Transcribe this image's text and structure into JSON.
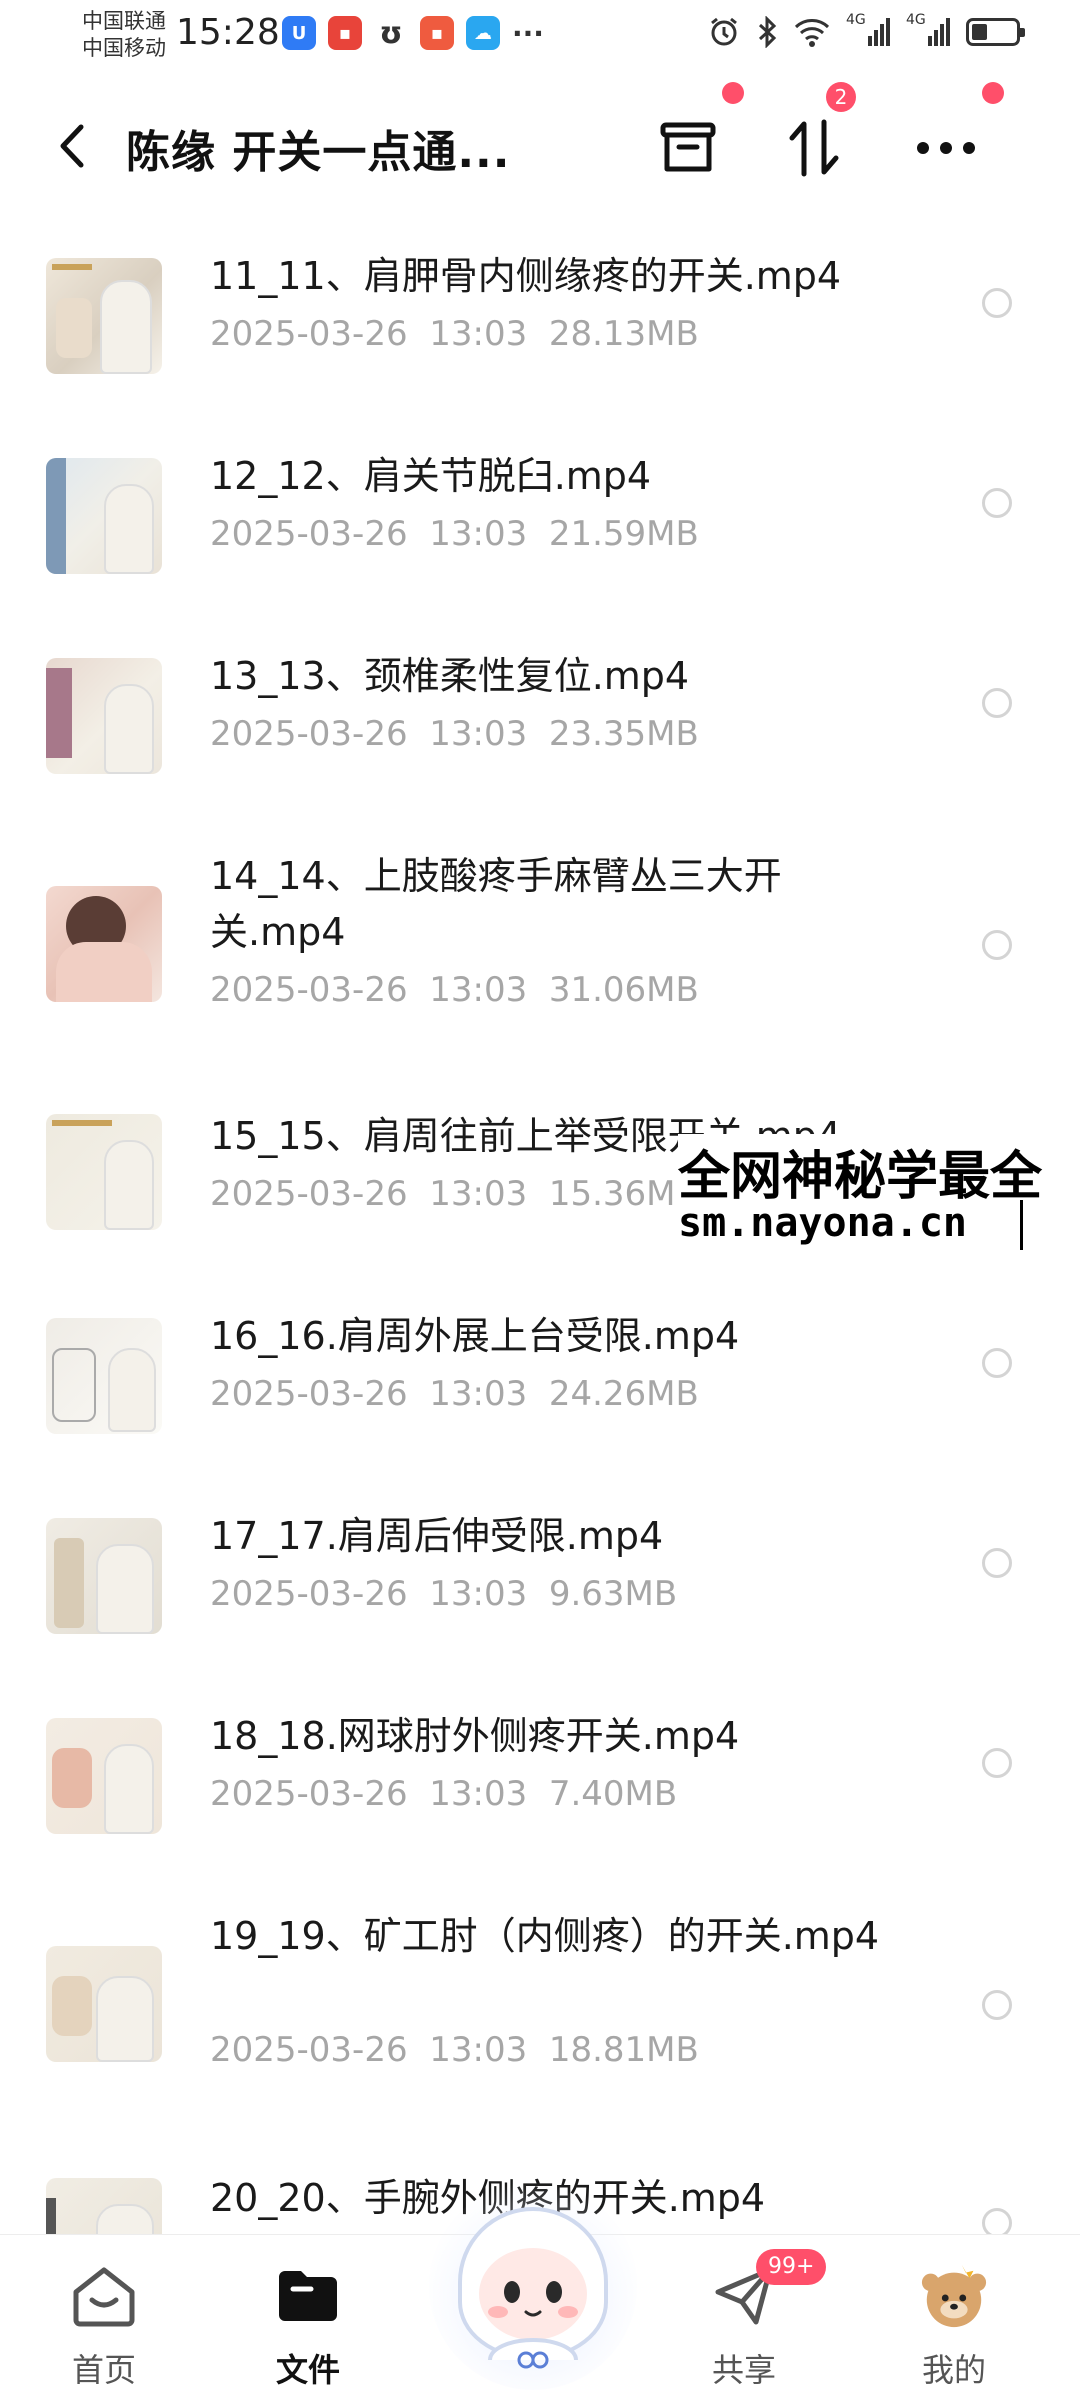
{
  "status_bar": {
    "carrier_1": "中国联通",
    "carrier_2": "中国移动",
    "time": "15:28",
    "signal_1": "4G",
    "signal_2": "4G",
    "battery_level": 0.35
  },
  "header": {
    "title": "陈缘 开关一点通...",
    "sort_badge": "2"
  },
  "files": [
    {
      "name": "11_11、肩胛骨内侧缘疼的开关.mp4",
      "date": "2025-03-26",
      "time": "13:03",
      "size": "28.13MB"
    },
    {
      "name": "12_12、肩关节脱臼.mp4",
      "date": "2025-03-26",
      "time": "13:03",
      "size": "21.59MB"
    },
    {
      "name": "13_13、颈椎柔性复位.mp4",
      "date": "2025-03-26",
      "time": "13:03",
      "size": "23.35MB"
    },
    {
      "name": "14_14、上肢酸疼手麻臂丛三大开关.mp4",
      "date": "2025-03-26",
      "time": "13:03",
      "size": "31.06MB"
    },
    {
      "name": "15_15、肩周往前上举受限开关.mp4",
      "date": "2025-03-26",
      "time": "13:03",
      "size": "15.36MB"
    },
    {
      "name": "16_16.肩周外展上台受限.mp4",
      "date": "2025-03-26",
      "time": "13:03",
      "size": "24.26MB"
    },
    {
      "name": "17_17.肩周后伸受限.mp4",
      "date": "2025-03-26",
      "time": "13:03",
      "size": "9.63MB"
    },
    {
      "name": "18_18.网球肘外侧疼开关.mp4",
      "date": "2025-03-26",
      "time": "13:03",
      "size": "7.40MB"
    },
    {
      "name": "19_19、矿工肘（内侧疼）的开关.mp4",
      "date": "2025-03-26",
      "time": "13:03",
      "size": "18.81MB"
    },
    {
      "name": "20_20、手腕外侧疼的开关.mp4",
      "date": "",
      "time": "",
      "size": ""
    }
  ],
  "watermark": {
    "line1": "全网神秘学最全",
    "line2": "sm.nayona.cn"
  },
  "nav": {
    "home": "首页",
    "files": "文件",
    "share": "共享",
    "share_badge": "99+",
    "mine": "我的"
  }
}
